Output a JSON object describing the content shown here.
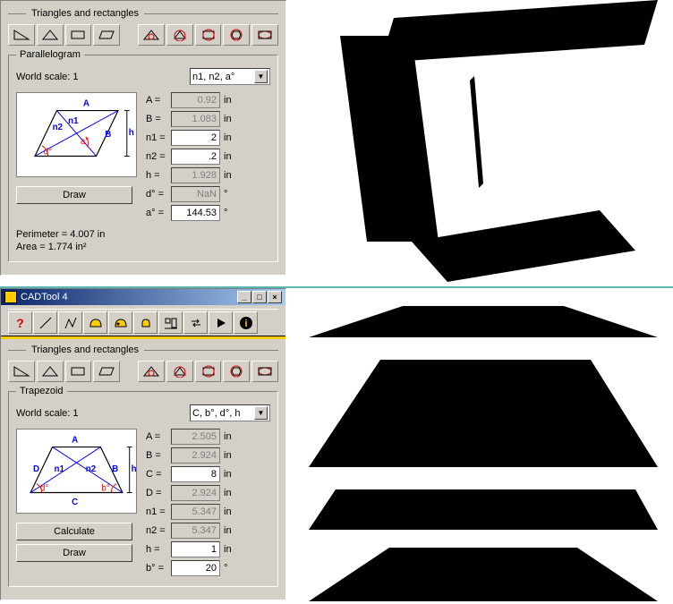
{
  "app_title": "CADTool 4",
  "section1": {
    "header": "Triangles and rectangles",
    "group_title": "Parallelogram",
    "scale_label": "World scale:  1",
    "select_value": "n1, n2, a°",
    "draw_label": "Draw",
    "fields": {
      "A_label": "A  =",
      "A_val": "0.92",
      "A_unit": "in",
      "B_label": "B  =",
      "B_val": "1.083",
      "B_unit": "in",
      "n1_label": "n1 =",
      "n1_val": "2",
      "n1_unit": "in",
      "n2_label": "n2 =",
      "n2_val": ".2",
      "n2_unit": "in",
      "h_label": "h  =",
      "h_val": "1.928",
      "h_unit": "in",
      "d_label": "d° =",
      "d_val": "NaN",
      "d_unit": "°",
      "a_label": "a° =",
      "a_val": "144.53",
      "a_unit": "°"
    },
    "perimeter_label": "Perimeter =  4.007 in",
    "area_label": "Area =  1.774 in²"
  },
  "section2": {
    "header": "Triangles and rectangles",
    "group_title": "Trapezoid",
    "scale_label": "World scale:  1",
    "select_value": "C, b°, d°, h",
    "calc_label": "Calculate",
    "draw_label": "Draw",
    "fields": {
      "A_label": "A  =",
      "A_val": "2.505",
      "A_unit": "in",
      "B_label": "B  =",
      "B_val": "2.924",
      "B_unit": "in",
      "C_label": "C  =",
      "C_val": "8",
      "C_unit": "in",
      "D_label": "D  =",
      "D_val": "2.924",
      "D_unit": "in",
      "n1_label": "n1 =",
      "n1_val": "5.347",
      "n1_unit": "in",
      "n2_label": "n2 =",
      "n2_val": "5.347",
      "n2_unit": "in",
      "h_label": "h  =",
      "h_val": "1",
      "h_unit": "in",
      "b_label": "b° =",
      "b_val": "20",
      "b_unit": "°"
    }
  }
}
